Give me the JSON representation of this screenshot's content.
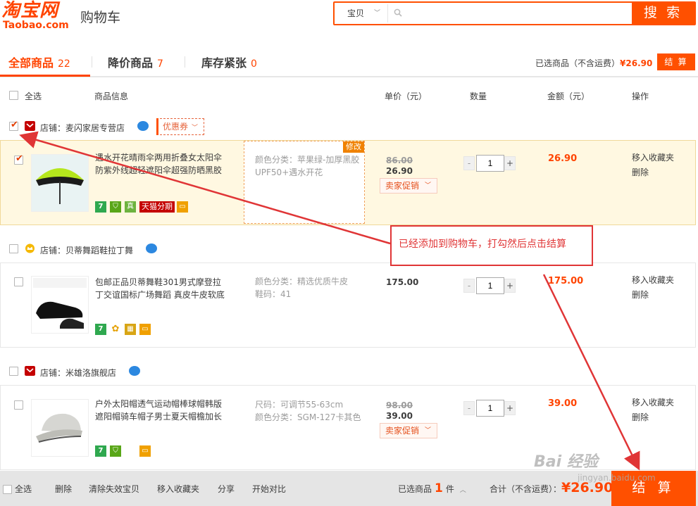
{
  "header": {
    "logo_cn": "淘宝网",
    "logo_en": "Taobao.com",
    "title": "购物车",
    "search_type": "宝贝",
    "search_value": "",
    "search_button": "搜 索"
  },
  "tabs": [
    {
      "label": "全部商品",
      "count": "22"
    },
    {
      "label": "降价商品",
      "count": "7"
    },
    {
      "label": "库存紧张",
      "count": "0"
    }
  ],
  "summary": {
    "label": "已选商品（不含运费）",
    "price": "¥26.90",
    "checkout": "结 算"
  },
  "columns": {
    "select_all": "全选",
    "info": "商品信息",
    "unit_price": "单价（元）",
    "quantity": "数量",
    "amount": "金额（元）",
    "action": "操作"
  },
  "shops": [
    {
      "prefix": "店铺：",
      "name": "麦闪家居专营店",
      "coupon": "优惠券",
      "checked": true,
      "item": {
        "checked": true,
        "title": "遇水开花晴雨伞两用折叠女太阳伞防紫外线超轻遮阳伞超强防晒黑胶",
        "sku_lines": [
          "颜色分类：苹果绿-加厚黑胶",
          "UPF50+遇水开花"
        ],
        "edit_label": "修改",
        "old_price": "86.00",
        "price": "26.90",
        "promo": "卖家促销",
        "quantity": "1",
        "amount": "26.90",
        "badge_tmall": "天猫分期",
        "ops": [
          "移入收藏夹",
          "删除"
        ]
      }
    },
    {
      "prefix": "店铺：",
      "name": "贝蒂舞蹈鞋拉丁舞",
      "checked": false,
      "item": {
        "checked": false,
        "title": "包邮正品贝蒂舞鞋301男式摩登拉丁交谊国标广场舞蹈 真皮牛皮软底",
        "sku_lines": [
          "颜色分类：精选优质牛皮",
          "鞋码：41"
        ],
        "price": "175.00",
        "quantity": "1",
        "amount": "175.00",
        "ops": [
          "移入收藏夹",
          "删除"
        ]
      }
    },
    {
      "prefix": "店铺：",
      "name": "米雄洛旗舰店",
      "checked": false,
      "item": {
        "checked": false,
        "title": "户外太阳帽透气运动帽棒球帽韩版遮阳帽骑车帽子男士夏天帽檐加长",
        "sku_lines": [
          "尺码：可调节55-63cm",
          "颜色分类：SGM-127卡其色"
        ],
        "old_price": "98.00",
        "price": "39.00",
        "promo": "卖家促销",
        "quantity": "1",
        "amount": "39.00",
        "ops": [
          "移入收藏夹",
          "删除"
        ]
      }
    }
  ],
  "badges": {
    "seven": "7",
    "zhen": "真"
  },
  "annotation": "已经添加到购物车，打勾然后点击结算",
  "bottom": {
    "select_all": "全选",
    "delete": "删除",
    "clear_invalid": "清除失效宝贝",
    "move_fav": "移入收藏夹",
    "share": "分享",
    "compare": "开始对比",
    "selected_label": "已选商品",
    "selected_count": "1",
    "selected_unit": "件",
    "total_label": "合计（不含运费）：",
    "total": "¥26.90",
    "checkout": "结 算"
  },
  "watermark": {
    "main": "Bai 经验",
    "sub": "jingyan.baidu.com"
  },
  "colors": {
    "accent": "#ff5000",
    "price": "#ff4400",
    "annotation": "#e03536",
    "selected_row": "#fff8e1"
  }
}
